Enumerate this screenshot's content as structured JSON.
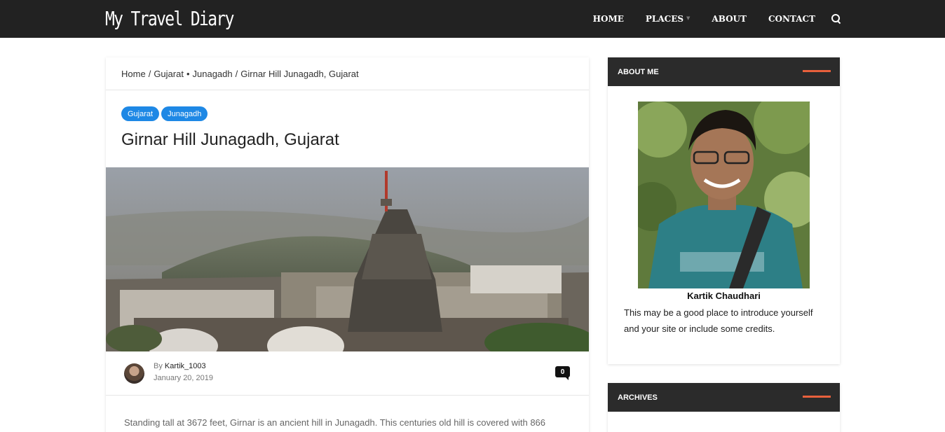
{
  "site": {
    "logo": "My Travel Diary"
  },
  "nav": {
    "items": [
      "HOME",
      "PLACES",
      "ABOUT",
      "CONTACT"
    ]
  },
  "icons": {
    "search": "search-icon",
    "comment": "comment-bubble-icon"
  },
  "colors": {
    "header_bg": "#222222",
    "label_blue": "#1e88e5",
    "accent": "#e8603c"
  },
  "breadcrumb": {
    "home": "Home",
    "sep1": "/",
    "cat1": "Gujarat",
    "dot": "•",
    "cat2": "Junagadh",
    "sep2": "/",
    "current": "Girnar Hill Junagadh, Gujarat"
  },
  "post": {
    "labels": [
      "Gujarat",
      "Junagadh"
    ],
    "title": "Girnar Hill Junagadh, Gujarat",
    "by_prefix": "By",
    "author": "Kartik_1003",
    "date": "January 20, 2019",
    "comment_count": "0",
    "excerpt": "Standing tall at 3672 feet, Girnar is an ancient hill in Junagadh. This centuries old hill is covered with 866"
  },
  "sidebar": {
    "about": {
      "title": "ABOUT ME",
      "name": "Kartik Chaudhari",
      "bio": "This may be a good place to introduce yourself and your site or include some credits."
    },
    "archives": {
      "title": "ARCHIVES"
    }
  }
}
